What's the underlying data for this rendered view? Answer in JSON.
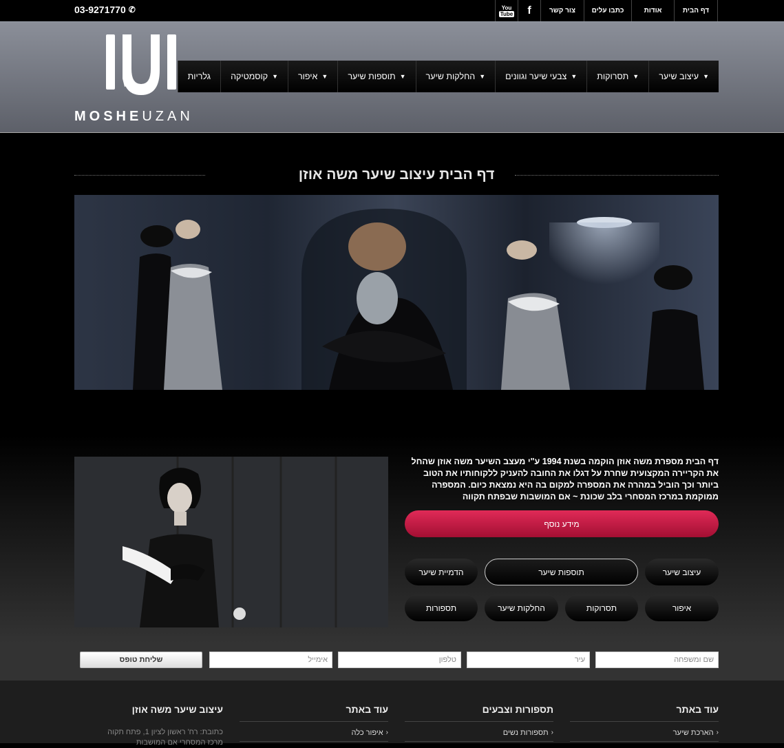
{
  "topbar": {
    "phone": "03-9271770",
    "links": [
      "דף הבית",
      "אודות",
      "כתבו עלים",
      "צור קשר"
    ],
    "social": {
      "facebook": "f",
      "youtube_top": "You",
      "youtube_bottom": "Tube"
    }
  },
  "header": {
    "logo_bold": "MOSHE",
    "logo_light": "UZAN",
    "nav": [
      "עיצוב שיער",
      "תסרוקות",
      "צבעי שיער וגוונים",
      "החלקות שיער",
      "תוספות שיער",
      "איפור",
      "קוסמטיקה",
      "גלריות"
    ]
  },
  "main": {
    "title": "דף הבית עיצוב שיער משה אוזן",
    "intro": "דף הבית מספרת משה אוזן הוקמה בשנת 1994 ע\"י מעצב השיער משה אוזן שהחל את הקריירה המקצועית שחרת על דגלו את החובה להעניק ללקוחותיו את הטוב ביותר וכך הוביל במהרה את המספרה למקום בה היא נמצאת כיום. המספרה ממוקמת במרכז המסחרי בלב שכונת ~ אם המושבות שבפתח תקווה",
    "more_button": "מידע נוסף",
    "pills": [
      "עיצוב שיער",
      "תוספות שיער",
      "הדמיית שיער",
      "איפור",
      "תסרוקות",
      "החלקות שיער",
      "תספורות"
    ]
  },
  "form": {
    "name_placeholder": "שם ומשפחה",
    "city_placeholder": "עיר",
    "phone_placeholder": "טלפון",
    "email_placeholder": "אימייל",
    "send_button": "שליחת טופס"
  },
  "footer": {
    "col1": {
      "title": "עוד באתר",
      "link": "הארכת שיער"
    },
    "col2": {
      "title": "תספורות וצבעים",
      "link": "תספורות נשים"
    },
    "col3": {
      "title": "עוד באתר",
      "link": "איפור כלה"
    },
    "col4": {
      "title": "עיצוב שיער משה אוזן",
      "address_line1": "כתובת: רח' ראשון לציון 1, פתח תקוה",
      "address_line2": "מרכז המסחרי אם המושבות"
    }
  }
}
